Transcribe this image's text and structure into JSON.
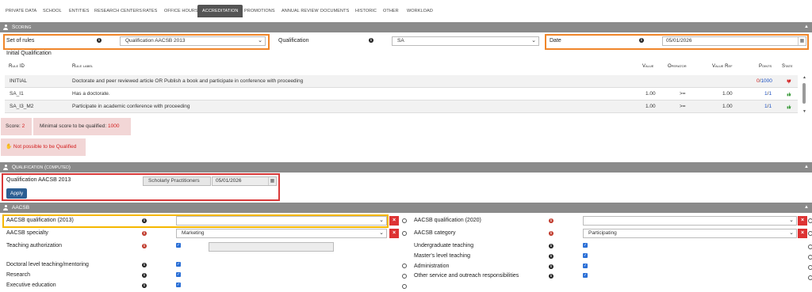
{
  "tabs": [
    {
      "label": "Private data"
    },
    {
      "label": "School"
    },
    {
      "label": "Entities"
    },
    {
      "label": "Research Centers"
    },
    {
      "label": "Rates"
    },
    {
      "label": "Office Hours"
    },
    {
      "label": "Accreditation"
    },
    {
      "label": "Promotions"
    },
    {
      "label": "Annual review"
    },
    {
      "label": "Documents"
    },
    {
      "label": "Historic"
    },
    {
      "label": "Other"
    },
    {
      "label": "Workload"
    }
  ],
  "scoring": {
    "title": "Scoring",
    "set_of_rules_label": "Set of rules",
    "set_of_rules_value": "Qualification AACSB 2013",
    "qualification_label": "Qualification",
    "qualification_value": "SA",
    "date_label": "Date",
    "date_value": "05/01/2026",
    "initial_qualification_label": "Initial Qualification",
    "headers": {
      "rule_id": "Rule ID",
      "rule_label": "Rule label",
      "value": "Value",
      "operator": "Operator",
      "value_ref": "Value Ref",
      "points": "Points",
      "state": "State"
    },
    "rows": [
      {
        "id": "INITIAL",
        "label": "Doctorate and peer reviewed article OR Publish a book and participate in conference with proceeding",
        "value": "",
        "operator": "",
        "value_ref": "",
        "points_a": "0",
        "points_b": "1000",
        "state": "down"
      },
      {
        "id": "SA_I1",
        "label": "Has a doctorate.",
        "value": "1.00",
        "operator": ">=",
        "value_ref": "1.00",
        "points_a": "1",
        "points_b": "1",
        "state": "up"
      },
      {
        "id": "SA_I3_M2",
        "label": "Participate in academic conference with proceeding",
        "value": "1.00",
        "operator": ">=",
        "value_ref": "1.00",
        "points_a": "1",
        "points_b": "1",
        "state": "up"
      }
    ],
    "score_label": "Score:",
    "score_value": "2",
    "min_score_label": "Minimal score to be qualified:",
    "min_score_value": "1000",
    "not_qualified_text": "Not possible to be Qualified"
  },
  "qualification_computed": {
    "title": "Qualification (computed)",
    "label": "Qualification AACSB 2013",
    "value": "Scholarly Practitioners",
    "date": "05/01/2026",
    "apply_label": "Apply"
  },
  "aacsb": {
    "title": "AACSB",
    "left": [
      {
        "label": "AACSB qualification (2013)",
        "type": "select",
        "value": ""
      },
      {
        "label": "AACSB specialty",
        "type": "select",
        "value": "Marketing"
      },
      {
        "label": "Teaching authorization",
        "type": "check_input"
      },
      {
        "label": "Doctoral level teaching/mentoring",
        "type": "check"
      },
      {
        "label": "Research",
        "type": "check"
      },
      {
        "label": "Executive education",
        "type": "check"
      }
    ],
    "right": [
      {
        "label": "AACSB qualification (2020)",
        "type": "select",
        "value": ""
      },
      {
        "label": "AACSB category",
        "type": "select",
        "value": "Participating"
      },
      {
        "label": "Undergraduate teaching",
        "type": "check"
      },
      {
        "label": "Master's level teaching",
        "type": "check"
      },
      {
        "label": "Administration",
        "type": "check"
      },
      {
        "label": "Other service and outreach responsibilities",
        "type": "check"
      }
    ]
  }
}
